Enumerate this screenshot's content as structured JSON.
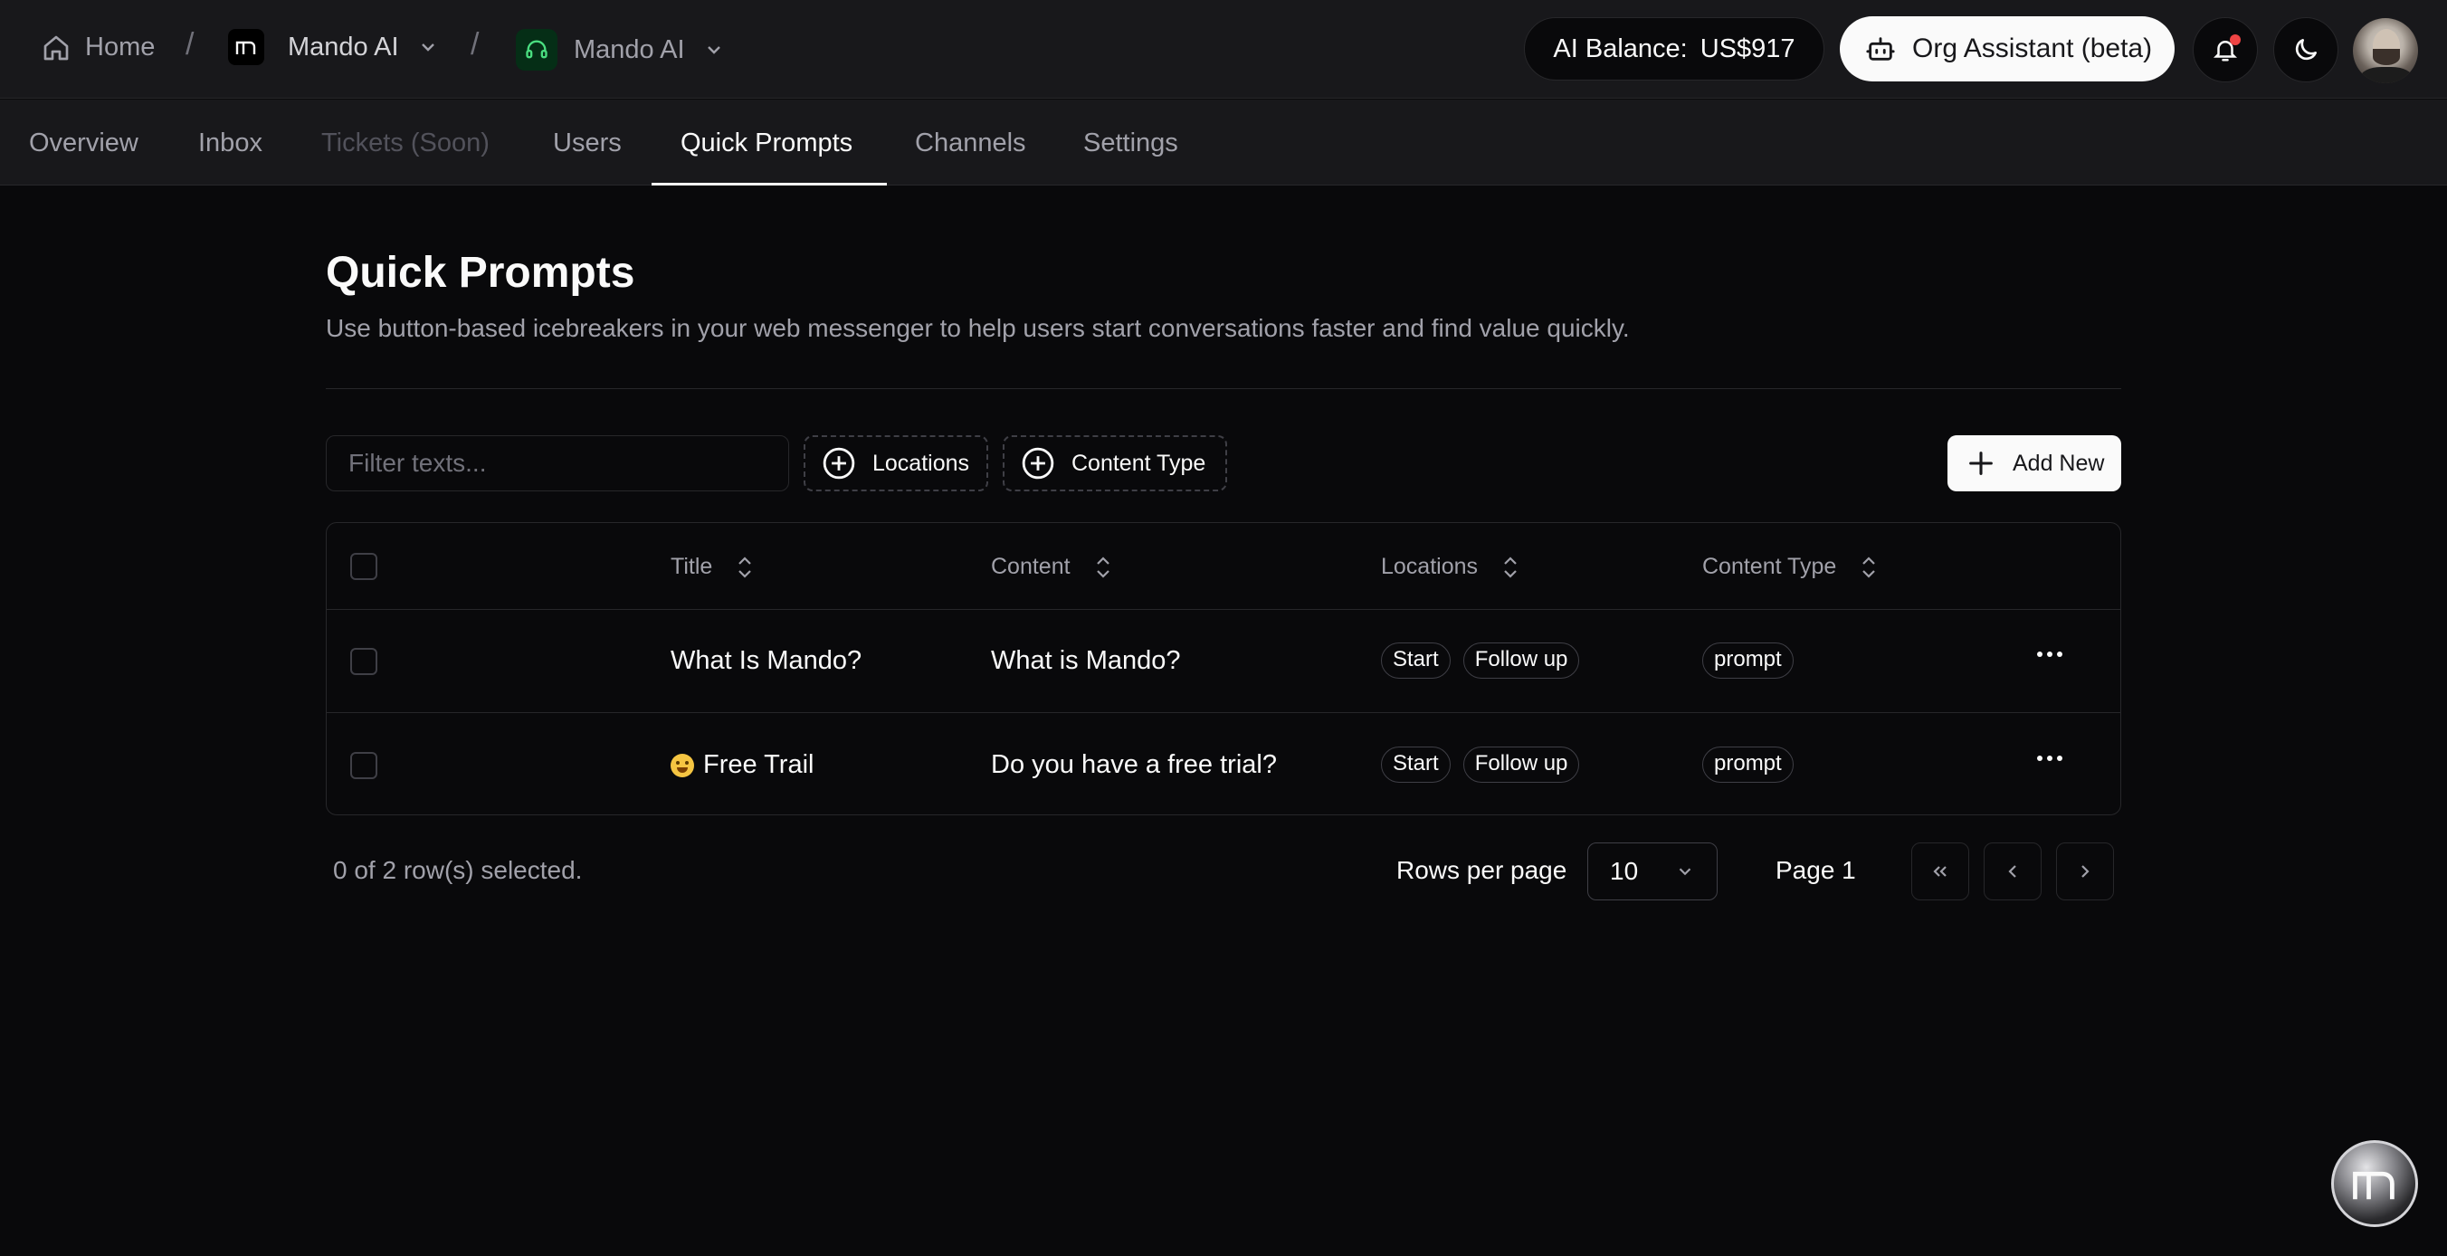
{
  "breadcrumbs": {
    "home": "Home",
    "org": "Mando AI",
    "project": "Mando AI",
    "separator": "/"
  },
  "header": {
    "balance_label": "AI Balance:",
    "balance_value": "US$917",
    "assistant_label": "Org Assistant (beta)"
  },
  "tabs": [
    {
      "label": "Overview"
    },
    {
      "label": "Inbox"
    },
    {
      "label": "Tickets (Soon)"
    },
    {
      "label": "Users"
    },
    {
      "label": "Quick Prompts"
    },
    {
      "label": "Channels"
    },
    {
      "label": "Settings"
    }
  ],
  "page": {
    "title": "Quick Prompts",
    "description": "Use button-based icebreakers in your web messenger to help users start conversations faster and find value quickly."
  },
  "toolbar": {
    "filter_placeholder": "Filter texts...",
    "facet_locations": "Locations",
    "facet_content_type": "Content Type",
    "add_new": "Add New"
  },
  "table": {
    "columns": [
      "Title",
      "Content",
      "Locations",
      "Content Type"
    ],
    "rows": [
      {
        "title": "What Is Mando?",
        "content": "What is Mando?",
        "locations": [
          "Start",
          "Follow up"
        ],
        "content_type": "prompt"
      },
      {
        "title": "Free Trail",
        "content": "Do you have a free trial?",
        "locations": [
          "Start",
          "Follow up"
        ],
        "content_type": "prompt"
      }
    ]
  },
  "pagination": {
    "selected_text": "0 of 2 row(s) selected.",
    "rows_per_page_label": "Rows per page",
    "rows_per_page_value": "10",
    "page_label": "Page 1"
  },
  "colors": {
    "background": "#09090b",
    "surface": "#18181b",
    "border": "#27272a",
    "notification_dot": "#ef4444"
  }
}
